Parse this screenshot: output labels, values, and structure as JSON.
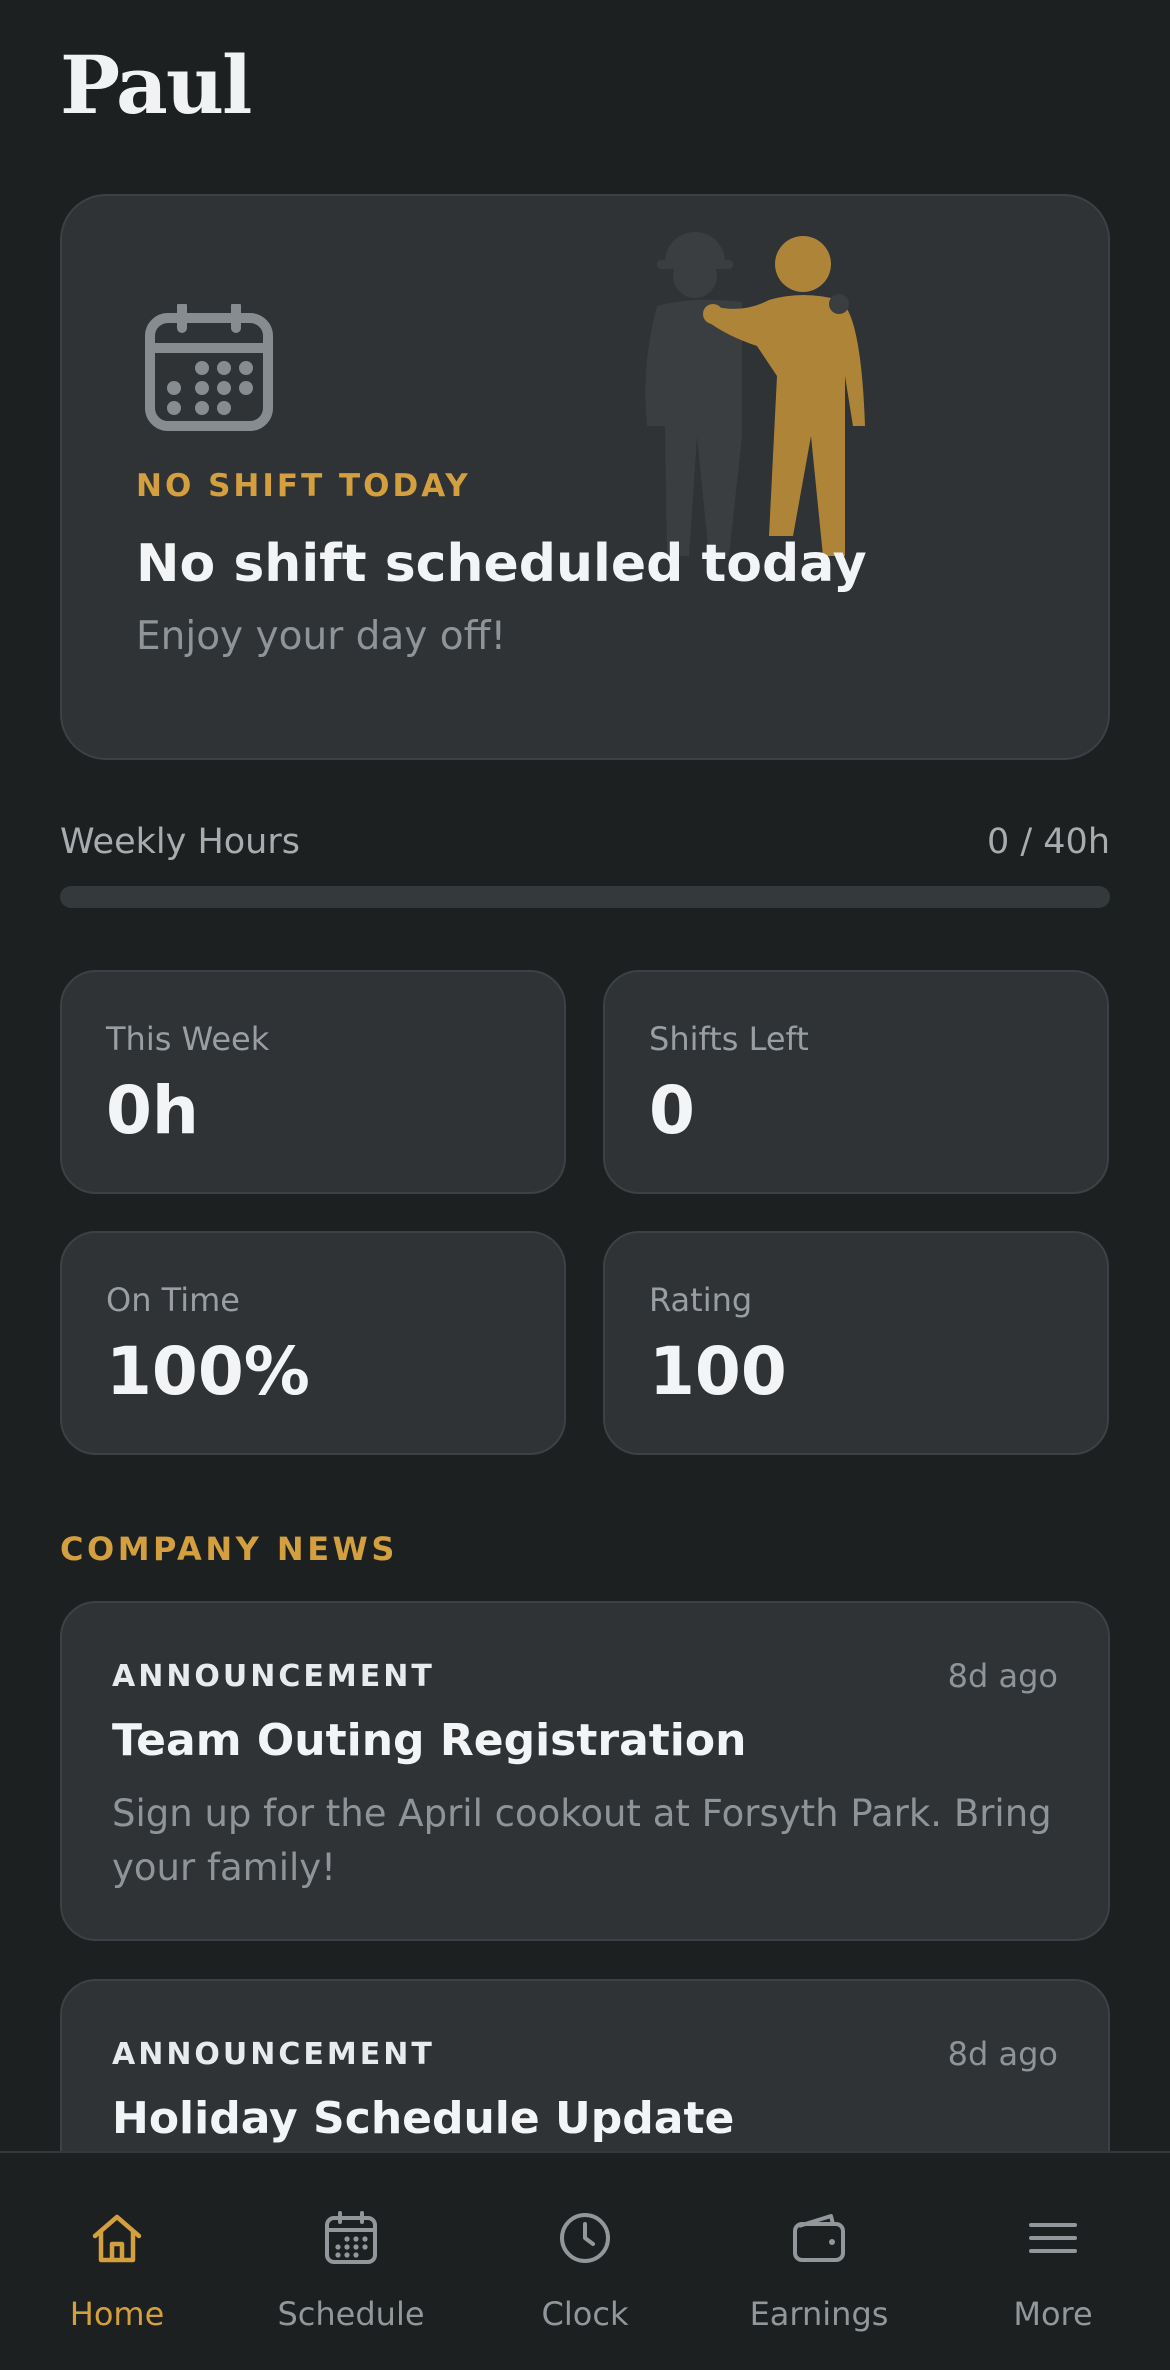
{
  "header": {
    "greeting": "Paul"
  },
  "hero": {
    "eyebrow": "NO SHIFT TODAY",
    "title": "No shift scheduled today",
    "subtitle": "Enjoy your day off!"
  },
  "weekly_hours": {
    "label": "Weekly Hours",
    "value_text": "0 / 40h",
    "hours_done": 0,
    "hours_target": 40
  },
  "stats": [
    {
      "label": "This Week",
      "value": "0h"
    },
    {
      "label": "Shifts Left",
      "value": "0"
    },
    {
      "label": "On Time",
      "value": "100%"
    },
    {
      "label": "Rating",
      "value": "100"
    }
  ],
  "news": {
    "heading": "COMPANY NEWS",
    "items": [
      {
        "tag": "ANNOUNCEMENT",
        "time": "8d ago",
        "title": "Team Outing Registration",
        "body": "Sign up for the April cookout at Forsyth Park. Bring your family!"
      },
      {
        "tag": "ANNOUNCEMENT",
        "time": "8d ago",
        "title": "Holiday Schedule Update",
        "body": ""
      }
    ]
  },
  "tabs": [
    {
      "label": "Home",
      "icon": "home-icon",
      "active": true
    },
    {
      "label": "Schedule",
      "icon": "calendar-icon",
      "active": false
    },
    {
      "label": "Clock",
      "icon": "clock-icon",
      "active": false
    },
    {
      "label": "Earnings",
      "icon": "wallet-icon",
      "active": false
    },
    {
      "label": "More",
      "icon": "menu-icon",
      "active": false
    }
  ],
  "colors": {
    "background": "#1d2021",
    "card": "#2f3336",
    "accent": "#d39f3f",
    "muted": "#8f9498"
  }
}
